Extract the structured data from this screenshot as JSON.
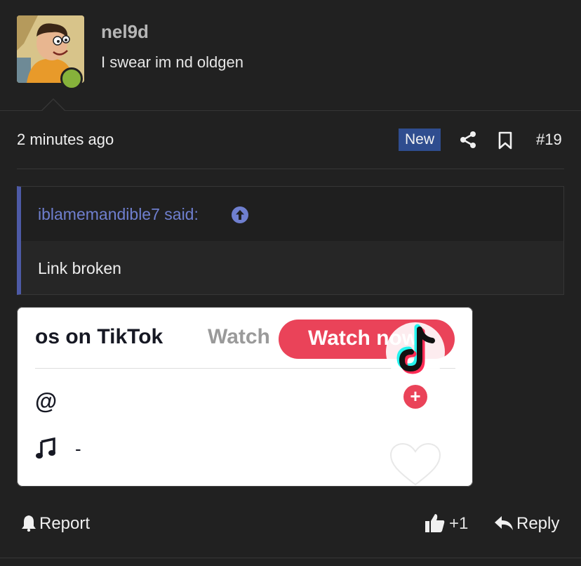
{
  "user": {
    "username": "nel9d",
    "title": "I swear im nd oldgen",
    "online": true
  },
  "post": {
    "time": "2 minutes ago",
    "badge": "New",
    "number": "#19"
  },
  "quote": {
    "author": "iblamemandible7 said:",
    "text": "Link broken"
  },
  "embed": {
    "title": "os on TikTok",
    "watch_ghost": "Watch",
    "watch_now": "Watch now",
    "plus": "+",
    "at": "@",
    "music_dash": "-"
  },
  "footer": {
    "report": "Report",
    "like_count": "+1",
    "reply": "Reply"
  },
  "colors": {
    "background": "#212121",
    "accent": "#4d5aa6",
    "badge": "#2f4d8f",
    "tiktok_red": "#ea4359",
    "online": "#86b23b"
  },
  "icons": [
    "share-icon",
    "bookmark-icon",
    "arrow-up-circle-icon",
    "tiktok-logo-icon",
    "music-note-icon",
    "heart-icon",
    "bell-icon",
    "thumbs-up-icon",
    "reply-arrow-icon"
  ]
}
